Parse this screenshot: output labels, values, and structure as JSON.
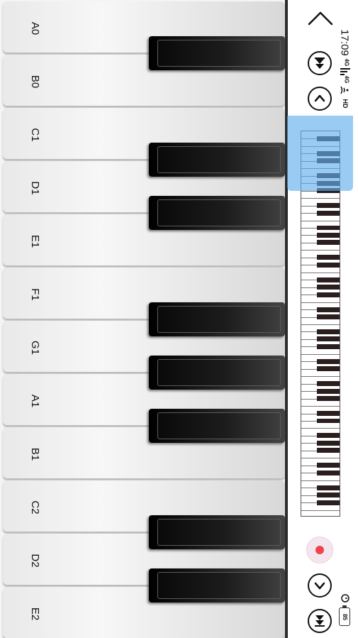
{
  "keyboard": {
    "white_keys": [
      "A0",
      "B0",
      "C1",
      "D1",
      "E1",
      "F1",
      "G1",
      "A1",
      "B1",
      "C2",
      "D2",
      "E2"
    ],
    "black_keys": [
      "A#0",
      "C#1",
      "D#1",
      "F#1",
      "G#1",
      "A#1",
      "C#2",
      "D#2"
    ]
  },
  "status_bar": {
    "time": "17:09",
    "network": "4G",
    "network2": "4G",
    "hd": "HD",
    "battery": "85"
  },
  "controls": {
    "back_icon": "chevron-left-icon",
    "scroll_up_icon": "chevron-up-icon",
    "scroll_down_icon": "chevron-down-icon",
    "skip_back_icon": "skip-start-icon",
    "skip_forward_icon": "skip-end-icon",
    "record_icon": "record-icon"
  },
  "colors": {
    "highlight": "#64afeb",
    "record": "#f0454f"
  }
}
